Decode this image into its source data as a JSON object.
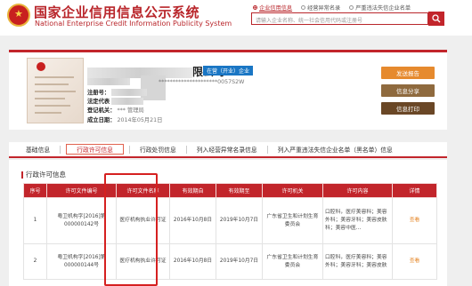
{
  "header": {
    "title_cn": "国家企业信用信息公示系统",
    "title_en": "National Enterprise Credit Information Publicity System",
    "nav": [
      {
        "label": "企业信用信息",
        "active": true
      },
      {
        "label": "经营异常名录",
        "active": false
      },
      {
        "label": "严重违法失信企业名单",
        "active": false
      }
    ],
    "search_placeholder": "请输入企业名称、统一社会信用代码或注册号"
  },
  "company": {
    "name_suffix": "限公司",
    "status": "在营（开业）企业",
    "fields": [
      {
        "key": "",
        "value": "*********************0057S2W"
      },
      {
        "key": "注册号：",
        "value": ""
      },
      {
        "key": "法定代表",
        "value": ""
      },
      {
        "key": "登记机关：",
        "value": "*** 管理局"
      },
      {
        "key": "成立日期：",
        "value": "2014年05月21日"
      }
    ],
    "buttons": {
      "report": "发送报告",
      "share": "信息分享",
      "print": "信息打印"
    }
  },
  "tabs": [
    {
      "label": "基础信息",
      "active": false
    },
    {
      "label": "行政许可信息",
      "active": true
    },
    {
      "label": "行政处罚信息",
      "active": false
    },
    {
      "label": "列入经营异常名录信息",
      "active": false
    },
    {
      "label": "列入严重违法失信企业名单（黑名单）信息",
      "active": false
    }
  ],
  "section": {
    "title": "行政许可信息",
    "columns": [
      "序号",
      "许可文件编号",
      "许可文件名称",
      "有效期自",
      "有效期至",
      "许可机关",
      "许可内容",
      "详情"
    ],
    "rows": [
      {
        "no": "1",
        "file_no": "粤卫机构字[2016]第000000142号",
        "file_name": "医疗机构执业许可证",
        "valid_from": "2016年10月8日",
        "valid_to": "2019年10月7日",
        "authority": "广东省卫生和计划生育委员会",
        "content": "口腔科，医疗美容科；美容外科；美容牙科；美容皮肤科；美容中医...",
        "detail": "查看"
      },
      {
        "no": "2",
        "file_no": "粤卫机构字[2016]第000000144号",
        "file_name": "医疗机构执业许可证",
        "valid_from": "2016年10月8日",
        "valid_to": "2019年10月7日",
        "authority": "广东省卫生和计划生育委员会",
        "content": "口腔科，医疗美容科；美容外科；美容牙科；美容皮肤",
        "detail": "查看"
      }
    ]
  },
  "colors": {
    "brand_red": "#c2252b",
    "status_blue": "#1a76c4",
    "orange": "#e68a2e"
  }
}
